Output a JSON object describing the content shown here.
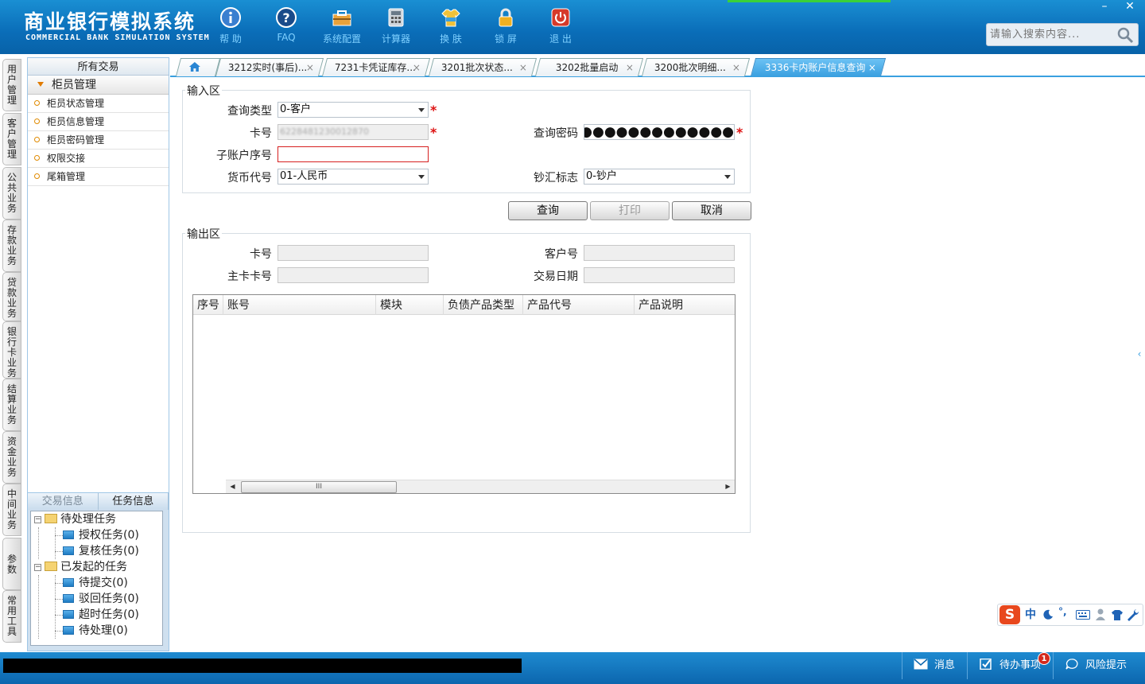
{
  "app": {
    "title_cn": "商业银行模拟系统",
    "title_en": "COMMERCIAL BANK SIMULATION SYSTEM"
  },
  "toolbar": [
    {
      "label": "帮 助",
      "icon": "info-icon"
    },
    {
      "label": "FAQ",
      "icon": "faq-icon"
    },
    {
      "label": "系统配置",
      "icon": "toolbox-icon"
    },
    {
      "label": "计算器",
      "icon": "calculator-icon"
    },
    {
      "label": "换 肤",
      "icon": "tshirt-icon"
    },
    {
      "label": "锁 屏",
      "icon": "lock-icon"
    },
    {
      "label": "退 出",
      "icon": "power-icon"
    }
  ],
  "window_controls": {
    "minimize": "–",
    "close": "✕"
  },
  "search": {
    "placeholder": "请输入搜索内容..."
  },
  "side_tabs": [
    "用户管理",
    "客户管理",
    "公共业务",
    "存款业务",
    "贷款业务",
    "银行卡业务",
    "结算业务",
    "资金业务",
    "中间业务",
    "参数",
    "常用工具"
  ],
  "menu": {
    "header": "所有交易",
    "group": "柜员管理",
    "items": [
      "柜员状态管理",
      "柜员信息管理",
      "柜员密码管理",
      "权限交接",
      "尾箱管理"
    ]
  },
  "task_panel": {
    "tabs": [
      "交易信息",
      "任务信息"
    ],
    "tree": {
      "pending": "待处理任务",
      "auth": "授权任务(0)",
      "review": "复核任务(0)",
      "initiated": "已发起的任务",
      "to_submit": "待提交(0)",
      "rejected": "驳回任务(0)",
      "timeout": "超时任务(0)",
      "to_process": "待处理(0)"
    }
  },
  "tabs": [
    {
      "label": "3212实时(事后)...",
      "close": "×"
    },
    {
      "label": "7231卡凭证库存...",
      "close": "×"
    },
    {
      "label": "3201批次状态...",
      "close": "×"
    },
    {
      "label": "3202批量启动",
      "close": "×"
    },
    {
      "label": "3200批次明细...",
      "close": "×"
    },
    {
      "label": "3336卡内账户信息查询",
      "close": "×",
      "active": true
    }
  ],
  "input_area": {
    "legend": "输入区",
    "query_type_label": "查询类型",
    "query_type_value": "0-客户",
    "card_no_label": "卡号",
    "card_no_value": "6228481230012870",
    "query_pwd_label": "查询密码",
    "query_pwd_value": "●●●●●●●●●●●●●●●",
    "sub_account_label": "子账户序号",
    "sub_account_value": "",
    "currency_label": "货币代号",
    "currency_value": "01-人民币",
    "cash_flag_label": "钞汇标志",
    "cash_flag_value": "0-钞户",
    "required_mark": "*"
  },
  "buttons": {
    "query": "查询",
    "print": "打印",
    "cancel": "取消"
  },
  "output_area": {
    "legend": "输出区",
    "card_no_label": "卡号",
    "customer_no_label": "客户号",
    "main_card_label": "主卡卡号",
    "trade_date_label": "交易日期",
    "columns": [
      "序号",
      "账号",
      "模块",
      "负债产品类型",
      "产品代号",
      "产品说明"
    ],
    "scroll_thumb": "III"
  },
  "statusbar": {
    "message": "消息",
    "todo": "待办事项",
    "todo_count": "1",
    "risk": "风险提示"
  },
  "ime": {
    "logo": "S",
    "lang": "中",
    "punct": "°,"
  }
}
